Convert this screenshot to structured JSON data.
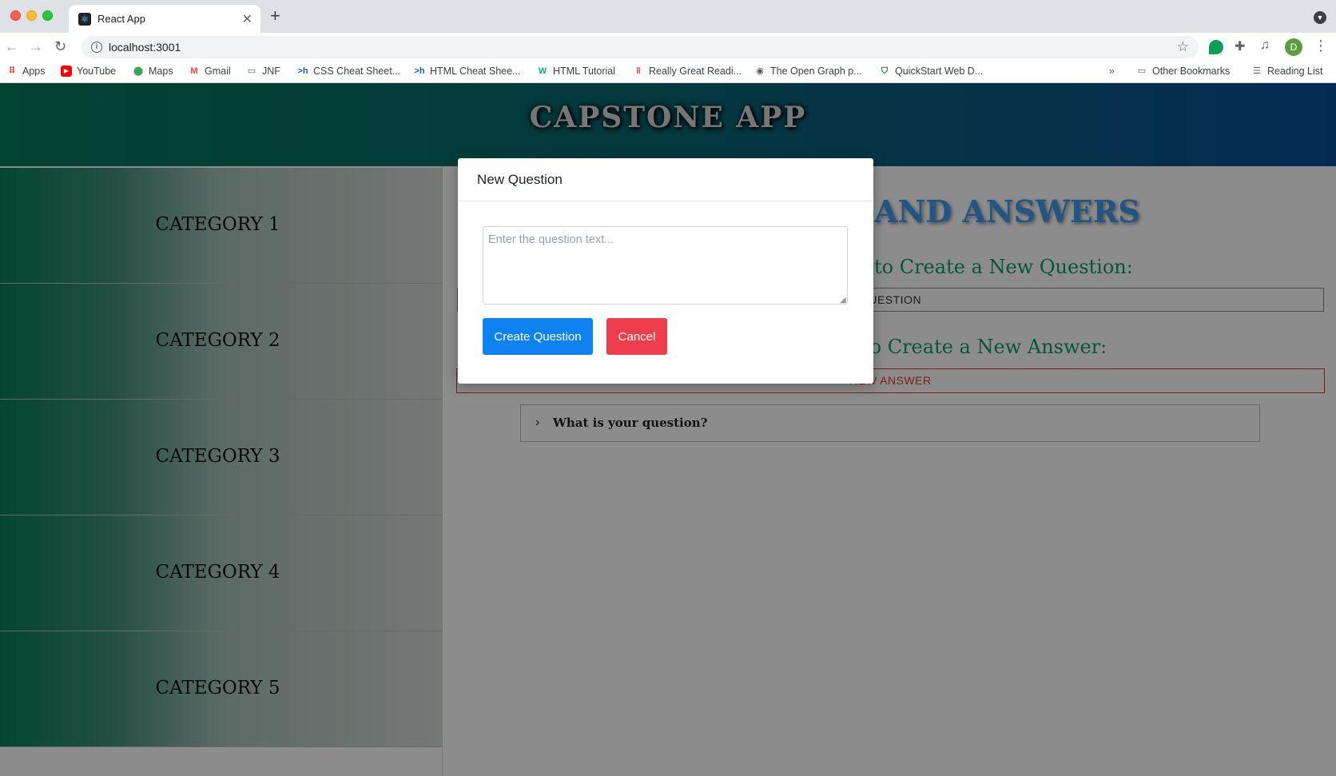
{
  "browser": {
    "tab_title": "React App",
    "url": "localhost:3001",
    "avatar_letter": "D",
    "bookmarks": [
      {
        "label": "Apps",
        "icon": "apps-grid-icon"
      },
      {
        "label": "YouTube",
        "icon": "youtube-icon"
      },
      {
        "label": "Maps",
        "icon": "maps-icon"
      },
      {
        "label": "Gmail",
        "icon": "gmail-icon"
      },
      {
        "label": "JNF",
        "icon": "folder-icon"
      },
      {
        "label": "CSS Cheat Sheet...",
        "icon": "hackr-icon"
      },
      {
        "label": "HTML Cheat Shee...",
        "icon": "hackr-icon"
      },
      {
        "label": "HTML Tutorial",
        "icon": "w3schools-icon"
      },
      {
        "label": "Really Great Readi...",
        "icon": "bars-icon"
      },
      {
        "label": "The Open Graph p...",
        "icon": "opengraph-icon"
      },
      {
        "label": "QuickStart Web D...",
        "icon": "shield-icon"
      }
    ],
    "other_bookmarks": "Other Bookmarks",
    "reading_list": "Reading List"
  },
  "app": {
    "title": "CAPSTONE APP",
    "categories": [
      "CATEGORY 1",
      "CATEGORY 2",
      "CATEGORY 3",
      "CATEGORY 4",
      "CATEGORY 5"
    ],
    "main": {
      "heading_visible": "AND ANSWERS",
      "instruction_question_visible": "to Create a New Question:",
      "new_question_button_visible": "QUESTION",
      "instruction_answer_visible": "to Create a New Answer:",
      "new_answer_button": "NEW ANSWER",
      "accordion_label": "What is your question?"
    }
  },
  "modal": {
    "title": "New Question",
    "textarea_value": "",
    "textarea_placeholder": "Enter the question text...",
    "create_button": "Create Question",
    "cancel_button": "Cancel"
  },
  "colors": {
    "header_start": "#067a5b",
    "header_end": "#0a4f98",
    "primary_button": "#0d82f0",
    "danger_button": "#ee3e4b",
    "instruction_text": "#0b9d6c",
    "heading_text": "#3b9cf0"
  }
}
